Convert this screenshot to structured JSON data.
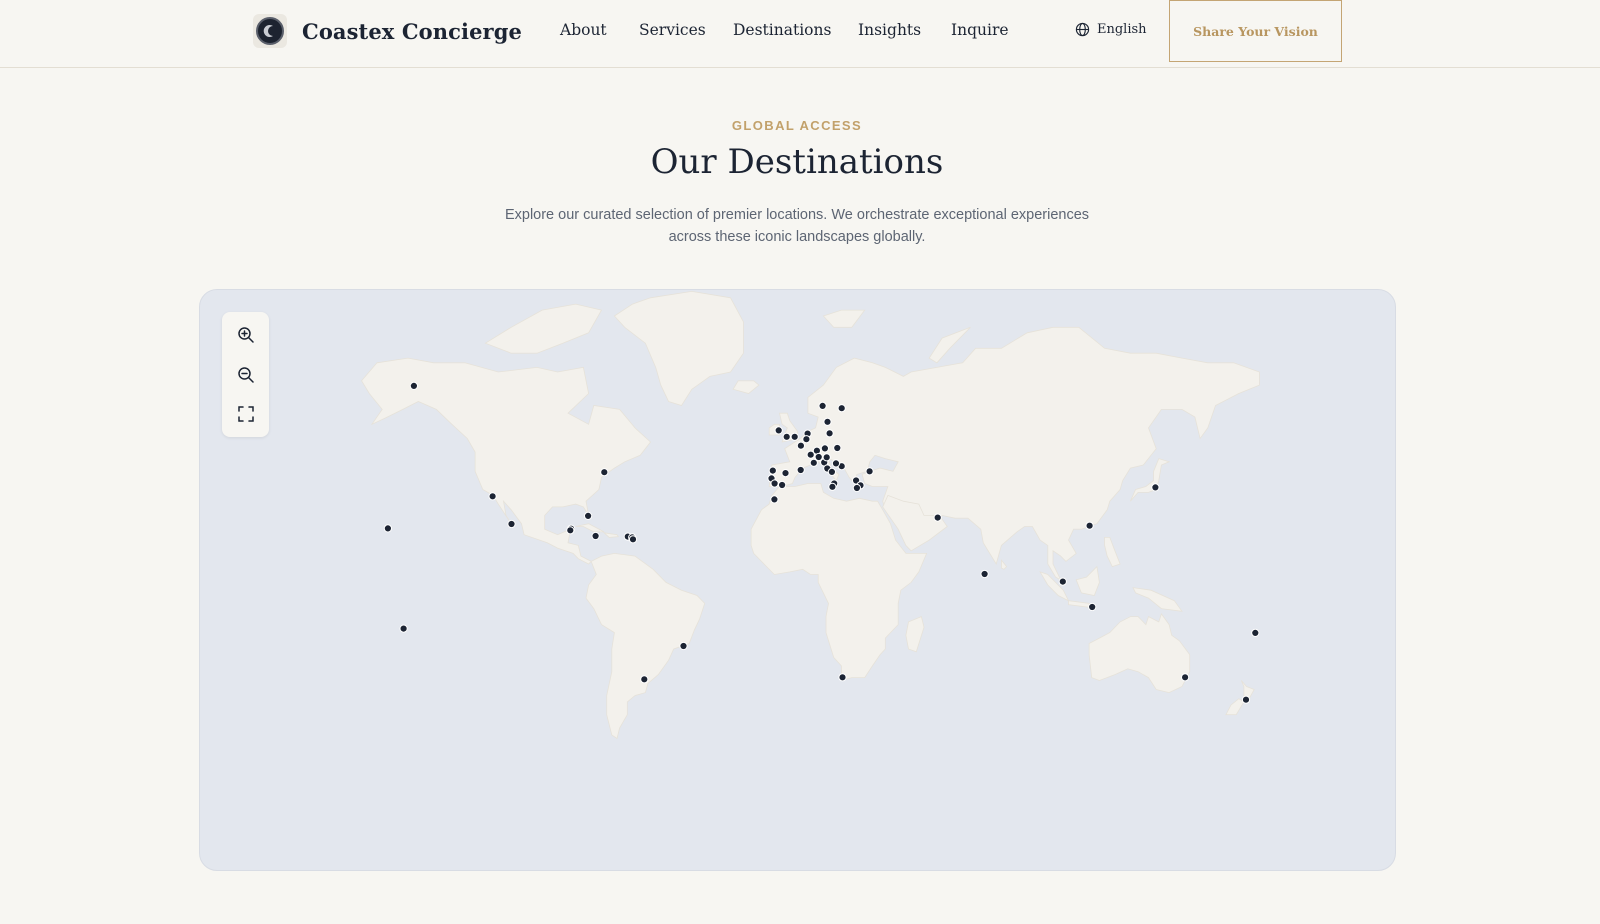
{
  "header": {
    "brand_name": "Coastex Concierge",
    "nav": [
      {
        "label": "About"
      },
      {
        "label": "Services"
      },
      {
        "label": "Destinations"
      },
      {
        "label": "Insights"
      },
      {
        "label": "Inquire"
      }
    ],
    "language": "English",
    "cta_label": "Share Your Vision"
  },
  "hero": {
    "eyebrow": "GLOBAL ACCESS",
    "title": "Our Destinations",
    "subtitle": "Explore our curated selection of premier locations. We orchestrate exceptional experiences across these iconic landscapes globally."
  },
  "map": {
    "controls": [
      "zoom-in-icon",
      "zoom-out-icon",
      "fullscreen-icon"
    ],
    "colors": {
      "ocean": "#e3e7ee",
      "land": "#f3f1ec",
      "marker": "#1c2433",
      "accent": "#c2a16b"
    },
    "destinations": [
      {
        "lon": -147.7,
        "lat": 64.8
      },
      {
        "lon": -157.8,
        "lat": 21.3
      },
      {
        "lon": -151.7,
        "lat": -16.5
      },
      {
        "lon": -117.2,
        "lat": 32.7
      },
      {
        "lon": -109.9,
        "lat": 22.9
      },
      {
        "lon": -73.9,
        "lat": 40.7
      },
      {
        "lon": -80.2,
        "lat": 25.8
      },
      {
        "lon": -86.8,
        "lat": 21.2
      },
      {
        "lon": -87.1,
        "lat": 20.6
      },
      {
        "lon": -77.3,
        "lat": 18.5
      },
      {
        "lon": -64.8,
        "lat": 18.3
      },
      {
        "lon": -63.1,
        "lat": 18.0
      },
      {
        "lon": -62.8,
        "lat": 17.3
      },
      {
        "lon": -43.2,
        "lat": -22.9
      },
      {
        "lon": -58.4,
        "lat": -34.6
      },
      {
        "lon": 18.4,
        "lat": -33.9
      },
      {
        "lon": 55.3,
        "lat": 25.2
      },
      {
        "lon": 73.5,
        "lat": 4.2
      },
      {
        "lon": 114.2,
        "lat": 22.3
      },
      {
        "lon": 103.8,
        "lat": 1.3
      },
      {
        "lon": 115.2,
        "lat": -8.4
      },
      {
        "lon": 139.7,
        "lat": 35.7
      },
      {
        "lon": 151.2,
        "lat": -33.9
      },
      {
        "lon": 174.8,
        "lat": -41.3
      },
      {
        "lon": 178.4,
        "lat": -18.1
      },
      {
        "lon": -6.3,
        "lat": 53.3
      },
      {
        "lon": -3.2,
        "lat": 51.5
      },
      {
        "lon": -0.1,
        "lat": 51.5
      },
      {
        "lon": 4.9,
        "lat": 52.4
      },
      {
        "lon": 4.4,
        "lat": 50.8
      },
      {
        "lon": 2.3,
        "lat": 48.9
      },
      {
        "lon": 10.7,
        "lat": 59.9
      },
      {
        "lon": 18.1,
        "lat": 59.3
      },
      {
        "lon": 12.6,
        "lat": 55.7
      },
      {
        "lon": 13.4,
        "lat": 52.5
      },
      {
        "lon": 8.5,
        "lat": 47.4
      },
      {
        "lon": 11.6,
        "lat": 48.1
      },
      {
        "lon": 16.4,
        "lat": 48.2
      },
      {
        "lon": 7.3,
        "lat": 43.7
      },
      {
        "lon": 9.2,
        "lat": 45.5
      },
      {
        "lon": 11.3,
        "lat": 43.8
      },
      {
        "lon": 12.3,
        "lat": 45.4
      },
      {
        "lon": 12.5,
        "lat": 41.9
      },
      {
        "lon": 14.3,
        "lat": 40.8
      },
      {
        "lon": 15.2,
        "lat": 37.0
      },
      {
        "lon": 6.1,
        "lat": 46.2
      },
      {
        "lon": 2.2,
        "lat": 41.4
      },
      {
        "lon": -3.7,
        "lat": 40.4
      },
      {
        "lon": -9.1,
        "lat": 38.7
      },
      {
        "lon": -8.6,
        "lat": 41.2
      },
      {
        "lon": -5.0,
        "lat": 36.5
      },
      {
        "lon": -7.9,
        "lat": 37.0
      },
      {
        "lon": -8.0,
        "lat": 31.6
      },
      {
        "lon": 18.1,
        "lat": 42.6
      },
      {
        "lon": 23.7,
        "lat": 38.0
      },
      {
        "lon": 25.4,
        "lat": 36.4
      },
      {
        "lon": 24.0,
        "lat": 35.5
      },
      {
        "lon": 28.9,
        "lat": 41.0
      },
      {
        "lon": 15.9,
        "lat": 43.5
      },
      {
        "lon": 14.5,
        "lat": 35.9
      }
    ]
  }
}
